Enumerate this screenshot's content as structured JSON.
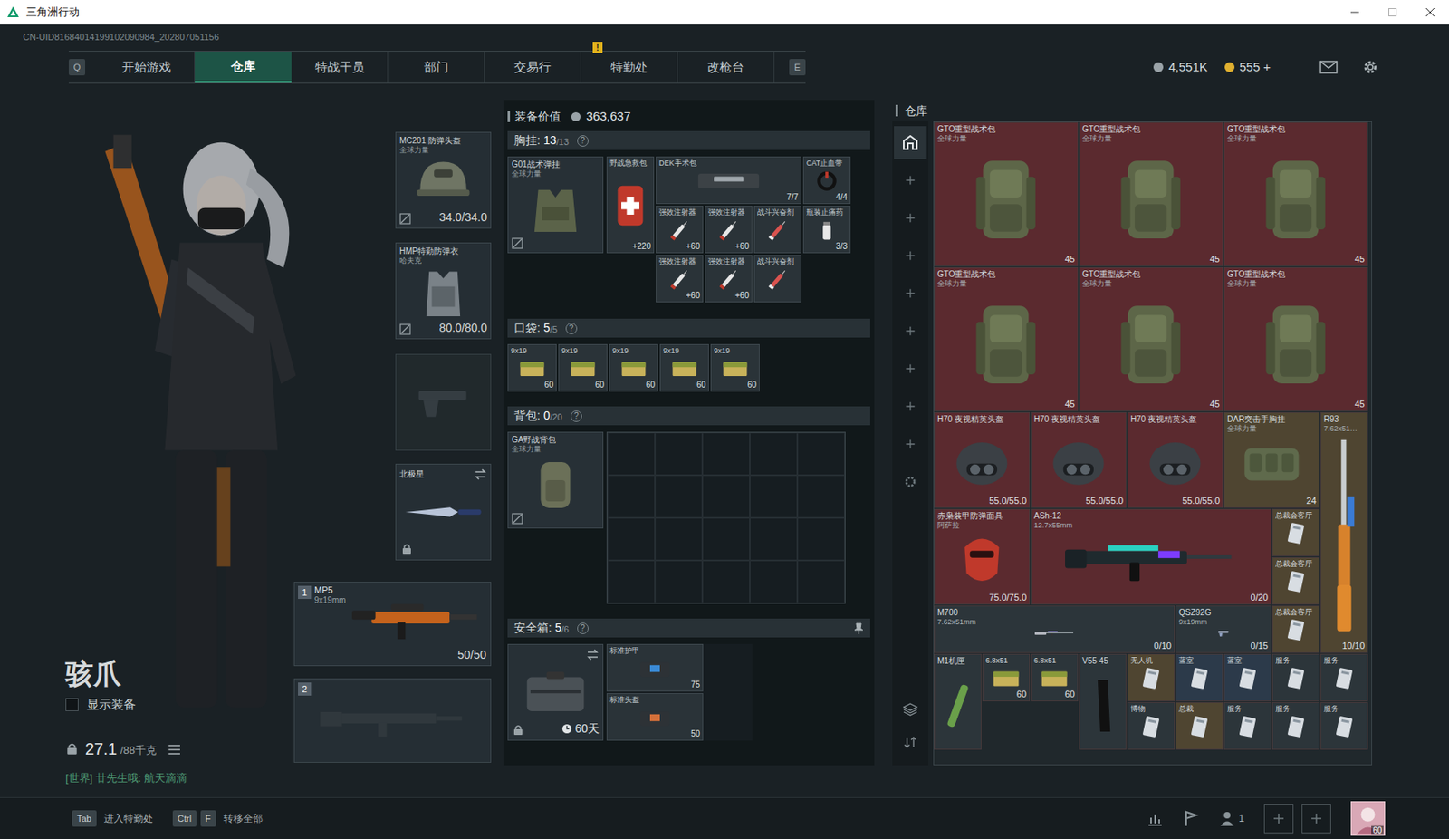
{
  "window": {
    "title": "三角洲行动"
  },
  "uid": "CN-UID81684014199102090984_202807051156",
  "nav": {
    "prev_key": "Q",
    "next_key": "E",
    "tabs": [
      {
        "label": "开始游戏",
        "selected": false
      },
      {
        "label": "仓库",
        "selected": true
      },
      {
        "label": "特战干员",
        "selected": false
      },
      {
        "label": "部门",
        "selected": false
      },
      {
        "label": "交易行",
        "selected": false
      },
      {
        "label": "特勤处",
        "selected": false,
        "badge": "!"
      },
      {
        "label": "改枪台",
        "selected": false
      }
    ]
  },
  "currency": [
    {
      "value": "4,551K",
      "kind": "silver"
    },
    {
      "value": "555 +",
      "kind": "gold"
    }
  ],
  "character": {
    "name": "骇爪",
    "show_equipment": {
      "label": "显示装备",
      "checked": false
    },
    "weight": "27.1",
    "weight_max": "/88千克",
    "chat": "[世界] 廿先生哦: 航天滴滴"
  },
  "equipment": {
    "helmet": {
      "name": "MC201 防弹头盔",
      "tag": "全球力量",
      "durability": "34.0/34.0"
    },
    "armor": {
      "name": "HMP特勤防弹衣",
      "tag": "哈夫克",
      "durability": "80.0/80.0"
    },
    "melee": {
      "name": "北极星",
      "locked": true
    },
    "weapons": [
      {
        "slot": "1",
        "name": "MP5",
        "caliber": "9x19mm",
        "ammo": "50/50",
        "empty": false
      },
      {
        "slot": "2",
        "empty": true
      }
    ]
  },
  "loadout": {
    "value_label": "装备价值",
    "value": "363,637",
    "chest_rig": {
      "title": "胸挂:",
      "count": "13",
      "capacity": "/13",
      "help": "?",
      "rig": {
        "name": "G01战术弹挂",
        "tag": "全球力量"
      },
      "items": [
        {
          "name": "野战急救包",
          "amount": "+220",
          "kind": "medkit"
        },
        {
          "name": "DEK手术包",
          "amount": "7/7",
          "kind": "surgerykit"
        },
        {
          "name": "CAT止血带",
          "amount": "4/4",
          "kind": "tourniquet"
        },
        {
          "name": "强效注射器",
          "amount": "+60",
          "kind": "syringe"
        },
        {
          "name": "强效注射器",
          "amount": "+60",
          "kind": "syringe"
        },
        {
          "name": "战斗兴奋剂",
          "kind": "stim"
        },
        {
          "name": "瓶装止痛药",
          "amount": "3/3",
          "kind": "pills"
        },
        {
          "name": "强效注射器",
          "amount": "+60",
          "kind": "syringe"
        },
        {
          "name": "强效注射器",
          "amount": "+60",
          "kind": "syringe"
        },
        {
          "name": "战斗兴奋剂",
          "kind": "stim"
        }
      ]
    },
    "pockets": {
      "title": "口袋:",
      "count": "5",
      "capacity": "/5",
      "help": "?",
      "items": [
        {
          "name": "9x19",
          "amount": "60"
        },
        {
          "name": "9x19",
          "amount": "60"
        },
        {
          "name": "9x19",
          "amount": "60"
        },
        {
          "name": "9x19",
          "amount": "60"
        },
        {
          "name": "9x19",
          "amount": "60"
        }
      ]
    },
    "backpack": {
      "title": "背包:",
      "count": "0",
      "capacity": "/20",
      "help": "?",
      "bag": {
        "name": "GA野战背包",
        "tag": "全球力量"
      }
    },
    "safe": {
      "title": "安全箱:",
      "count": "5",
      "capacity": "/6",
      "help": "?",
      "expiry": "60天",
      "items": [
        {
          "name": "标准护甲",
          "amount": "75",
          "kind": "armorbox"
        },
        {
          "name": "标准头盔",
          "amount": "50",
          "kind": "helmetbox"
        }
      ]
    }
  },
  "warehouse": {
    "title": "仓库",
    "items": [
      {
        "name": "GTO重型战术包",
        "tag": "全球力量",
        "amount": "45",
        "color": "#5b2a2f",
        "kind": "bag"
      },
      {
        "name": "GTO重型战术包",
        "tag": "全球力量",
        "amount": "45",
        "color": "#5b2a2f",
        "kind": "bag"
      },
      {
        "name": "GTO重型战术包",
        "tag": "全球力量",
        "amount": "45",
        "color": "#5b2a2f",
        "kind": "bag"
      },
      {
        "name": "GTO重型战术包",
        "tag": "全球力量",
        "amount": "45",
        "color": "#5b2a2f",
        "kind": "bag"
      },
      {
        "name": "GTO重型战术包",
        "tag": "全球力量",
        "amount": "45",
        "color": "#5b2a2f",
        "kind": "bag"
      },
      {
        "name": "GTO重型战术包",
        "tag": "全球力量",
        "amount": "45",
        "color": "#5b2a2f",
        "kind": "bag"
      },
      {
        "name": "H70 夜视精英头盔",
        "amount": "55.0/55.0",
        "color": "#5b2a2f",
        "kind": "nvg"
      },
      {
        "name": "H70 夜视精英头盔",
        "amount": "55.0/55.0",
        "color": "#5b2a2f",
        "kind": "nvg"
      },
      {
        "name": "H70 夜视精英头盔",
        "amount": "55.0/55.0",
        "color": "#5b2a2f",
        "kind": "nvg"
      },
      {
        "name": "DAR突击手胸挂",
        "tag": "全球力量",
        "amount": "24",
        "color": "#4f4531",
        "kind": "rig"
      },
      {
        "name": "R93",
        "tag": "7.62x51…",
        "amount": "10/10",
        "color": "#4f4531",
        "kind": "longrifle"
      },
      {
        "name": "赤枭装甲防弹面具",
        "tag": "阿萨拉",
        "amount": "75.0/75.0",
        "color": "#5b2a2f",
        "kind": "mask"
      },
      {
        "name": "ASh-12",
        "tag": "12.7x55mm",
        "amount": "0/20",
        "color": "#5b2a2f",
        "kind": "rifle"
      },
      {
        "name": "总裁会客厅",
        "color": "#4f4531",
        "kind": "keycard"
      },
      {
        "name": "总裁会客厅",
        "color": "#4f4531",
        "kind": "keycard"
      },
      {
        "name": "总裁会客厅",
        "color": "#4f4531",
        "kind": "keycard"
      },
      {
        "name": "M700",
        "tag": "7.62x51mm",
        "amount": "0/10",
        "color": "#2c353a",
        "kind": "sniper"
      },
      {
        "name": "QSZ92G",
        "tag": "9x19mm",
        "amount": "0/15",
        "color": "#2c353a",
        "kind": "pistol"
      },
      {
        "name": "M1机匣",
        "color": "#2c353a",
        "kind": "receiver"
      },
      {
        "name": "6.8x51",
        "amount": "60",
        "color": "#2c353a",
        "kind": "ammo"
      },
      {
        "name": "6.8x51",
        "amount": "60",
        "color": "#2c353a",
        "kind": "ammo"
      },
      {
        "name": "V55 45",
        "color": "#2c353a",
        "kind": "magazine"
      },
      {
        "name": "无人机",
        "color": "#4f4531",
        "kind": "keycard"
      },
      {
        "name": "蓝室",
        "color": "#2c3a4a",
        "kind": "keycard"
      },
      {
        "name": "蓝室",
        "color": "#2c3a4a",
        "kind": "keycard"
      },
      {
        "name": "服务",
        "color": "#2c353a",
        "kind": "keycard"
      },
      {
        "name": "服务",
        "color": "#2c353a",
        "kind": "keycard"
      },
      {
        "name": "博物",
        "color": "#2c353a",
        "kind": "keycard"
      },
      {
        "name": "总裁",
        "color": "#4f4531",
        "kind": "keycard"
      },
      {
        "name": "服务",
        "color": "#2c353a",
        "kind": "keycard"
      },
      {
        "name": "服务",
        "color": "#2c353a",
        "kind": "keycard"
      },
      {
        "name": "服务",
        "color": "#2c353a",
        "kind": "keycard"
      }
    ]
  },
  "bottom_bar": {
    "hints": [
      {
        "keys": [
          "Tab"
        ],
        "label": "进入特勤处"
      },
      {
        "keys": [
          "Ctrl",
          "F"
        ],
        "label": "转移全部"
      }
    ],
    "party": "1",
    "level": "60"
  }
}
